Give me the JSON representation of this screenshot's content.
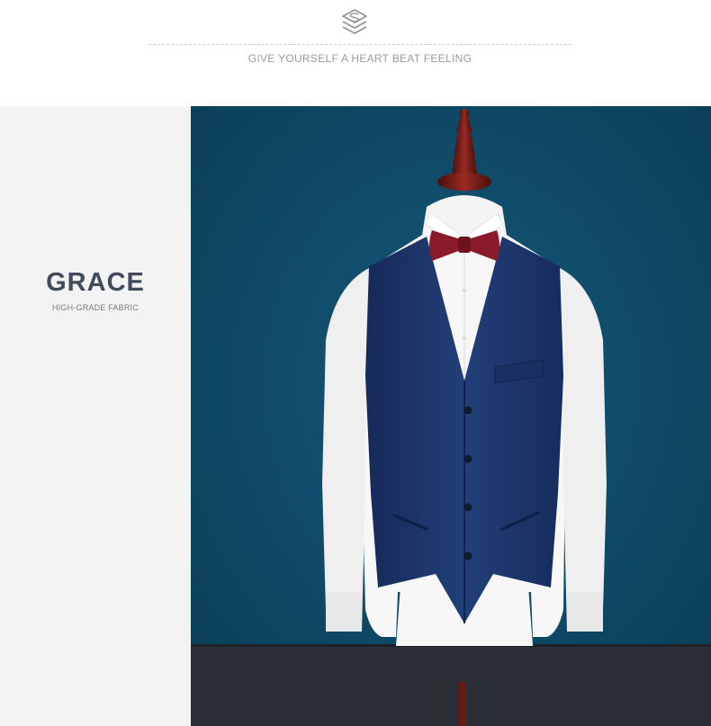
{
  "header": {
    "logo_icon": "stacked-s-logo-icon",
    "tagline": "GIVE YOURSELF A HEART BEAT FEELING"
  },
  "side": {
    "title": "GRACE",
    "subtitle": "HIGH-GRADE FABRIC"
  },
  "photo": {
    "subject": "product-photo",
    "colors": {
      "background": "#0f4a68",
      "vest": "#1c3567",
      "shirt": "#f7f7f7",
      "bowtie": "#8a1a2a",
      "stand": "#7d1f1a",
      "floor": "#2b2f35"
    }
  }
}
